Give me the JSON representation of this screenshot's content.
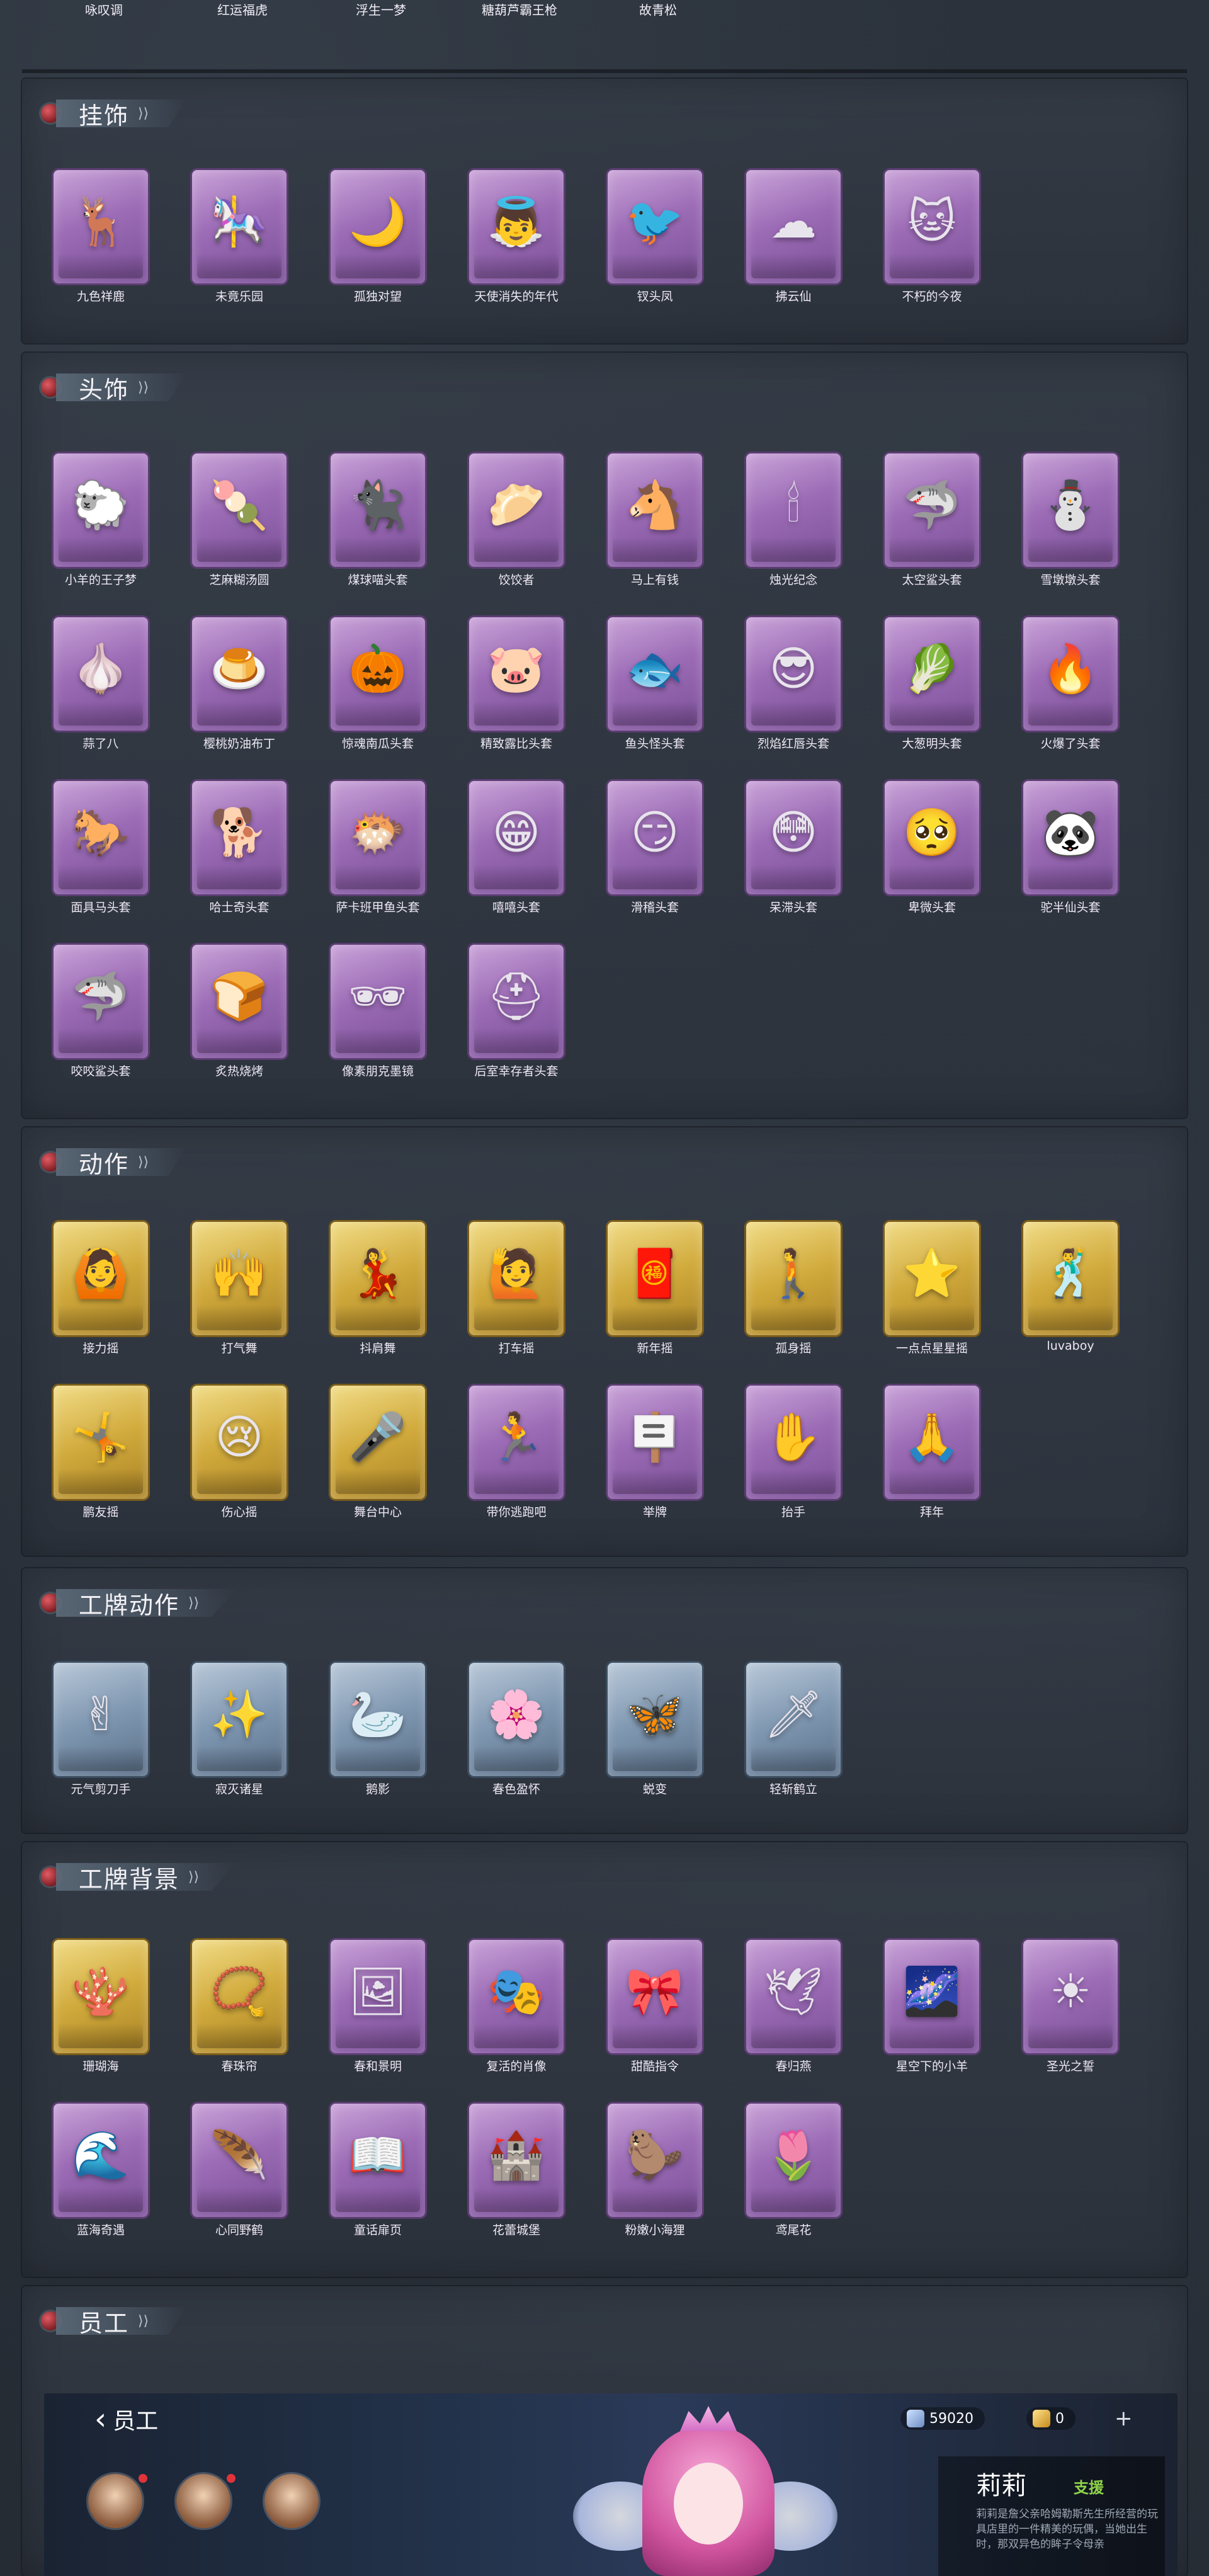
{
  "top_row": [
    "咏叹调",
    "红运福虎",
    "浮生一梦",
    "糖葫芦霸王枪",
    "故青松"
  ],
  "sections": {
    "pendants": {
      "title": "挂饰",
      "items": [
        {
          "label": "九色祥鹿",
          "glyph": "🦌"
        },
        {
          "label": "未竟乐园",
          "glyph": "🎠"
        },
        {
          "label": "孤独对望",
          "glyph": "🌙"
        },
        {
          "label": "天使消失的年代",
          "glyph": "👼"
        },
        {
          "label": "钗头凤",
          "glyph": "🐦"
        },
        {
          "label": "拂云仙",
          "glyph": "☁"
        },
        {
          "label": "不朽的今夜",
          "glyph": "🐱"
        }
      ]
    },
    "headwear": {
      "title": "头饰",
      "items": [
        {
          "label": "小羊的王子梦",
          "glyph": "🐑"
        },
        {
          "label": "芝麻糊汤圆",
          "glyph": "🍡"
        },
        {
          "label": "煤球喵头套",
          "glyph": "🐈‍⬛"
        },
        {
          "label": "饺饺者",
          "glyph": "🥟"
        },
        {
          "label": "马上有钱",
          "glyph": "🐴"
        },
        {
          "label": "烛光纪念",
          "glyph": "🕯"
        },
        {
          "label": "太空鲨头套",
          "glyph": "🦈"
        },
        {
          "label": "雪墩墩头套",
          "glyph": "⛄"
        },
        {
          "label": "蒜了八",
          "glyph": "🧄"
        },
        {
          "label": "樱桃奶油布丁",
          "glyph": "🍮"
        },
        {
          "label": "惊魂南瓜头套",
          "glyph": "🎃"
        },
        {
          "label": "精致露比头套",
          "glyph": "🐷"
        },
        {
          "label": "鱼头怪头套",
          "glyph": "🐟"
        },
        {
          "label": "烈焰红唇头套",
          "glyph": "😎"
        },
        {
          "label": "大葱明头套",
          "glyph": "🥬"
        },
        {
          "label": "火爆了头套",
          "glyph": "🔥"
        },
        {
          "label": "面具马头套",
          "glyph": "🐎"
        },
        {
          "label": "哈士奇头套",
          "glyph": "🐕"
        },
        {
          "label": "萨卡班甲鱼头套",
          "glyph": "🐡"
        },
        {
          "label": "嘻嘻头套",
          "glyph": "😁"
        },
        {
          "label": "滑稽头套",
          "glyph": "😏"
        },
        {
          "label": "呆滞头套",
          "glyph": "😳"
        },
        {
          "label": "卑微头套",
          "glyph": "🥺"
        },
        {
          "label": "驼半仙头套",
          "glyph": "🐼"
        },
        {
          "label": "咬咬鲨头套",
          "glyph": "🦈"
        },
        {
          "label": "炙热烧烤",
          "glyph": "🍞"
        },
        {
          "label": "像素朋克墨镜",
          "glyph": "🕶"
        },
        {
          "label": "后室幸存者头套",
          "glyph": "⛑"
        }
      ]
    },
    "emotes": {
      "title": "动作",
      "items": [
        {
          "label": "接力摇",
          "glyph": "🙆"
        },
        {
          "label": "打气舞",
          "glyph": "🙌"
        },
        {
          "label": "抖肩舞",
          "glyph": "💃"
        },
        {
          "label": "打车摇",
          "glyph": "🙋"
        },
        {
          "label": "新年摇",
          "glyph": "🧧"
        },
        {
          "label": "孤身摇",
          "glyph": "🚶"
        },
        {
          "label": "一点点星星摇",
          "glyph": "⭐"
        },
        {
          "label": "luvaboy",
          "glyph": "🕺"
        },
        {
          "label": "鹏友摇",
          "glyph": "🤸"
        },
        {
          "label": "伤心摇",
          "glyph": "😢"
        },
        {
          "label": "舞台中心",
          "glyph": "🎤"
        },
        {
          "label": "带你逃跑吧",
          "glyph": "🏃"
        },
        {
          "label": "举牌",
          "glyph": "🪧"
        },
        {
          "label": "抬手",
          "glyph": "✋"
        },
        {
          "label": "拜年",
          "glyph": "🙏"
        }
      ]
    },
    "badge_actions": {
      "title": "工牌动作",
      "items": [
        {
          "label": "元气剪刀手",
          "glyph": "✌"
        },
        {
          "label": "寂灭诸星",
          "glyph": "✨"
        },
        {
          "label": "鹅影",
          "glyph": "🦢"
        },
        {
          "label": "春色盈怀",
          "glyph": "🌸"
        },
        {
          "label": "蜕变",
          "glyph": "🦋"
        },
        {
          "label": "轻斩鹤立",
          "glyph": "🗡"
        }
      ]
    },
    "badge_backgrounds": {
      "title": "工牌背景",
      "items": [
        {
          "label": "珊瑚海",
          "glyph": "🪸",
          "color": "gold"
        },
        {
          "label": "春珠帘",
          "glyph": "📿",
          "color": "gold"
        },
        {
          "label": "春和景明",
          "glyph": "🖼",
          "color": "purple"
        },
        {
          "label": "复活的肖像",
          "glyph": "🎭",
          "color": "purple"
        },
        {
          "label": "甜酷指令",
          "glyph": "🎀",
          "color": "purple"
        },
        {
          "label": "春归燕",
          "glyph": "🕊",
          "color": "purple"
        },
        {
          "label": "星空下的小羊",
          "glyph": "🌌",
          "color": "purple"
        },
        {
          "label": "圣光之誓",
          "glyph": "☀",
          "color": "purple"
        },
        {
          "label": "蓝海奇遇",
          "glyph": "🌊",
          "color": "purple"
        },
        {
          "label": "心同野鹤",
          "glyph": "🪶",
          "color": "purple"
        },
        {
          "label": "童话扉页",
          "glyph": "📖",
          "color": "purple"
        },
        {
          "label": "花蕾城堡",
          "glyph": "🏰",
          "color": "purple"
        },
        {
          "label": "粉嫩小海狸",
          "glyph": "🦫",
          "color": "purple"
        },
        {
          "label": "鸢尾花",
          "glyph": "🌷",
          "color": "purple"
        }
      ]
    },
    "staff": {
      "title": "员工",
      "back_label": "员工",
      "currency_a": "59020",
      "currency_b": "0",
      "plus": "+",
      "character_name": "莉莉",
      "character_tag": "支援",
      "character_desc": "莉莉是詹父亲哈姆勒斯先生所经营的玩具店里的一件精美的玩偶，当她出生时，那双异色的眸子令母亲"
    }
  },
  "colors": {
    "purple_card": "#9c6cb6",
    "gold_card": "#d1aa3c",
    "blue_card": "#7f97b1",
    "bg": "#2a3038"
  }
}
